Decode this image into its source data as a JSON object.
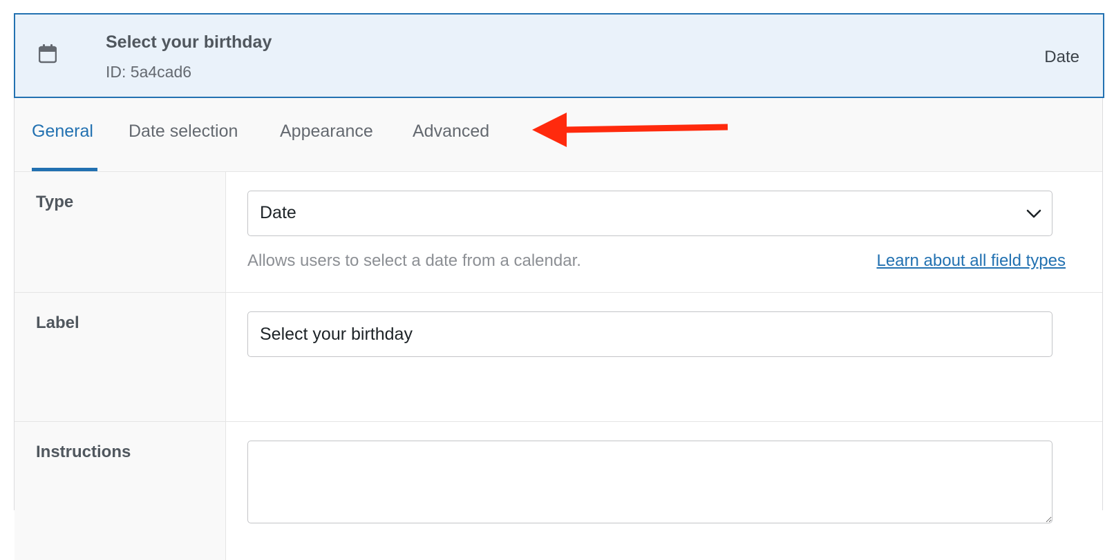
{
  "header": {
    "icon": "calendar-icon",
    "title": "Select your birthday",
    "id_text": "ID: 5a4cad6",
    "type_text": "Date"
  },
  "tabs": [
    {
      "label": "General",
      "active": true
    },
    {
      "label": "Date selection",
      "active": false
    },
    {
      "label": "Appearance",
      "active": false
    },
    {
      "label": "Advanced",
      "active": false
    }
  ],
  "annotation": {
    "icon": "red-arrow-icon",
    "color": "#ff2a0d"
  },
  "rows": {
    "type": {
      "label": "Type",
      "selected": "Date",
      "description": "Allows users to select a date from a calendar.",
      "link": "Learn about all field types"
    },
    "label": {
      "label": "Label",
      "value": "Select your birthday"
    },
    "instructions": {
      "label": "Instructions",
      "value": ""
    }
  },
  "colors": {
    "accent": "#2271b1",
    "header_bg": "#eaf2fa"
  }
}
